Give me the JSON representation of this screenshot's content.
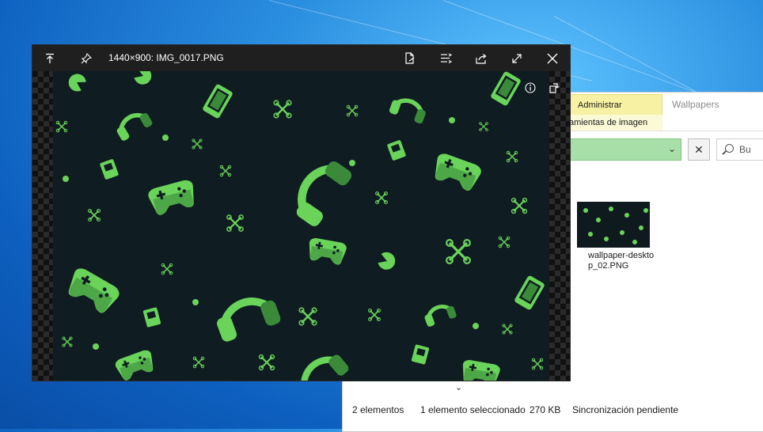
{
  "viewer": {
    "title": "1440×900: IMG_0017.PNG",
    "toolbar": {
      "upload_icon": "arrow-up-to-line-icon",
      "pin_icon": "pin-icon",
      "edit_icon": "document-edit-icon",
      "options_icon": "list-options-icon",
      "share_icon": "share-icon",
      "fullscreen_icon": "expand-icon",
      "close_icon": "close-icon"
    },
    "overlay": {
      "info_icon": "info-icon",
      "rotate_icon": "rotate-icon"
    },
    "image_description_colors": {
      "background": "#0f1c21",
      "accent": "#6ad35a",
      "accent_dark": "#3a8a3a"
    }
  },
  "explorer": {
    "contextual_tab": "Administrar",
    "contextual_subtab": "amientas de imagen",
    "folder_title": "Wallpapers",
    "search_placeholder": "Bu",
    "file": {
      "name": "wallpaper-desktop_02.PNG"
    },
    "status": {
      "count": "2 elementos",
      "selection": "1 elemento seleccionado",
      "size": "270 KB",
      "sync": "Sincronización pendiente"
    }
  }
}
